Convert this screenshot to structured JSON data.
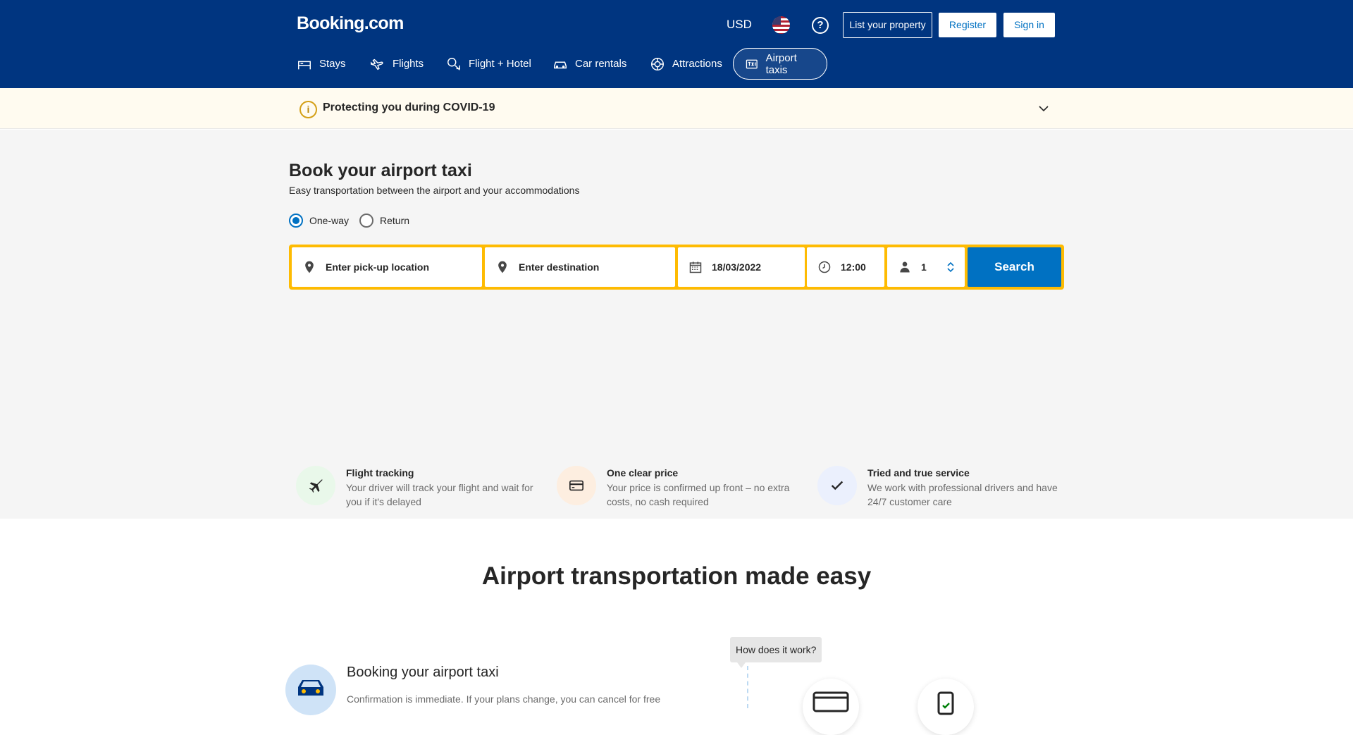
{
  "header": {
    "logo": "Booking.com",
    "currency": "USD",
    "help_glyph": "?",
    "list_property": "List your property",
    "register": "Register",
    "sign_in": "Sign in"
  },
  "nav": {
    "items": [
      {
        "label": "Stays",
        "icon": "bed-icon"
      },
      {
        "label": "Flights",
        "icon": "plane-icon"
      },
      {
        "label": "Flight + Hotel",
        "icon": "flight-hotel-icon"
      },
      {
        "label": "Car rentals",
        "icon": "car-icon"
      },
      {
        "label": "Attractions",
        "icon": "attractions-icon"
      },
      {
        "label": "Airport taxis",
        "icon": "taxi-icon",
        "active": true
      }
    ]
  },
  "covid": {
    "title": "Protecting you during COVID-19",
    "icon_glyph": "i"
  },
  "hero": {
    "title": "Book your airport taxi",
    "subtitle": "Easy transportation between the airport and your accommodations",
    "trip_options": [
      {
        "label": "One-way",
        "selected": true
      },
      {
        "label": "Return",
        "selected": false
      }
    ]
  },
  "search": {
    "pickup_placeholder": "Enter pick-up location",
    "destination_placeholder": "Enter destination",
    "date": "18/03/2022",
    "time": "12:00",
    "passengers": "1",
    "button": "Search"
  },
  "features": [
    {
      "title": "Flight tracking",
      "description": "Your driver will track your flight and wait for you if it's delayed",
      "icon": "plane-icon",
      "color": "#e9f8ea"
    },
    {
      "title": "One clear price",
      "description": "Your price is confirmed up front – no extra costs, no cash required",
      "icon": "credit-card-icon",
      "color": "#fdeee0"
    },
    {
      "title": "Tried and true service",
      "description": "We work with professional drivers and have 24/7 customer care",
      "icon": "checkmark-icon",
      "color": "#ebf0fd"
    }
  ],
  "made_easy": {
    "title": "Airport transportation made easy",
    "booking_title": "Booking your airport taxi",
    "booking_desc": "Confirmation is immediate. If your plans change, you can cancel for free",
    "how_bubble": "How does it work?"
  },
  "colors": {
    "brand": "#003580",
    "search_border": "#febb02",
    "button": "#0071c2"
  }
}
